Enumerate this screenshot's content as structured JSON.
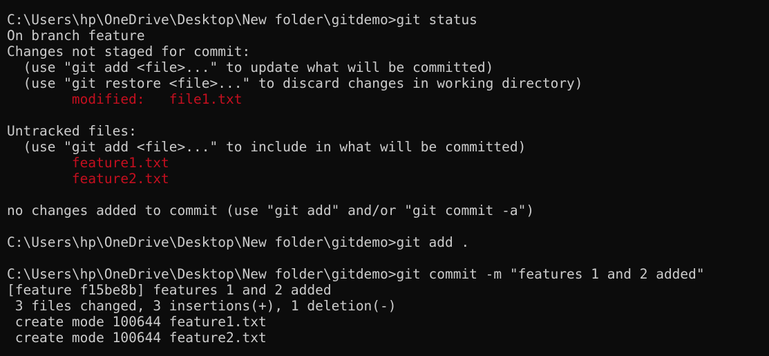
{
  "colors": {
    "background": "#0c0c0c",
    "text": "#cccccc",
    "highlight_red": "#c50f1f"
  },
  "terminal": {
    "lines": [
      {
        "text": "C:\\Users\\hp\\OneDrive\\Desktop\\New folder\\gitdemo>git status",
        "color": "default"
      },
      {
        "text": "On branch feature",
        "color": "default"
      },
      {
        "text": "Changes not staged for commit:",
        "color": "default"
      },
      {
        "text": "  (use \"git add <file>...\" to update what will be committed)",
        "color": "default"
      },
      {
        "text": "  (use \"git restore <file>...\" to discard changes in working directory)",
        "color": "default"
      },
      {
        "text": "        modified:   file1.txt",
        "color": "red"
      },
      {
        "text": "",
        "color": "default"
      },
      {
        "text": "Untracked files:",
        "color": "default"
      },
      {
        "text": "  (use \"git add <file>...\" to include in what will be committed)",
        "color": "default"
      },
      {
        "text": "        feature1.txt",
        "color": "red"
      },
      {
        "text": "        feature2.txt",
        "color": "red"
      },
      {
        "text": "",
        "color": "default"
      },
      {
        "text": "no changes added to commit (use \"git add\" and/or \"git commit -a\")",
        "color": "default"
      },
      {
        "text": "",
        "color": "default"
      },
      {
        "text": "C:\\Users\\hp\\OneDrive\\Desktop\\New folder\\gitdemo>git add .",
        "color": "default"
      },
      {
        "text": "",
        "color": "default"
      },
      {
        "text": "C:\\Users\\hp\\OneDrive\\Desktop\\New folder\\gitdemo>git commit -m \"features 1 and 2 added\"",
        "color": "default"
      },
      {
        "text": "[feature f15be8b] features 1 and 2 added",
        "color": "default"
      },
      {
        "text": " 3 files changed, 3 insertions(+), 1 deletion(-)",
        "color": "default"
      },
      {
        "text": " create mode 100644 feature1.txt",
        "color": "default"
      },
      {
        "text": " create mode 100644 feature2.txt",
        "color": "default"
      }
    ]
  }
}
